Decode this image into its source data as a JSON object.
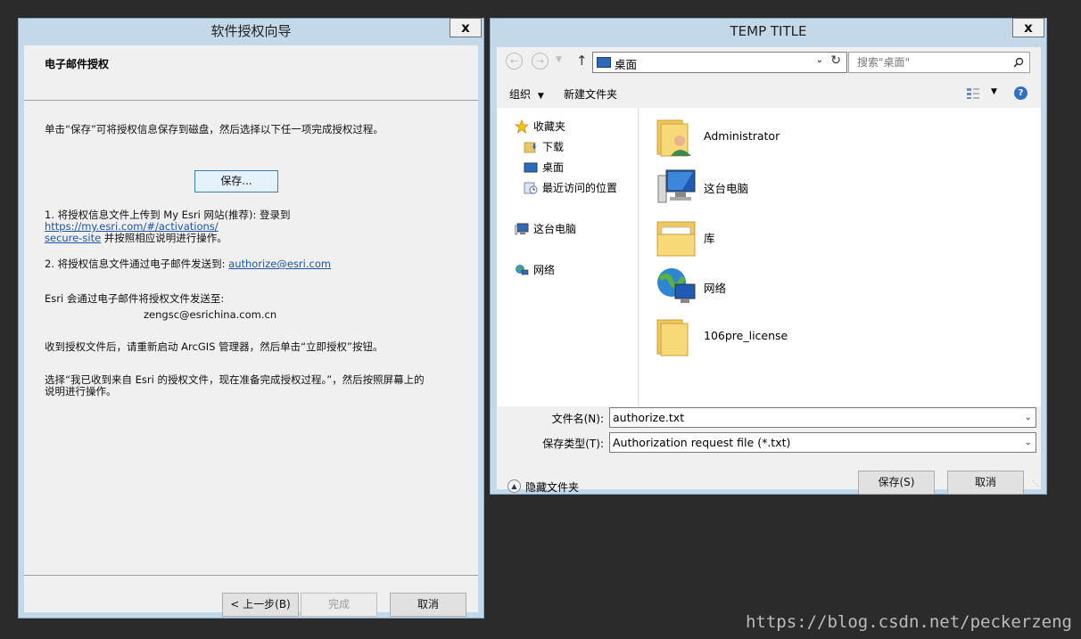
{
  "left_window": {
    "title": "软件授权向导",
    "close_label": "x",
    "header": "电子邮件授权",
    "intro": "单击“保存”可将授权信息保存到磁盘，然后选择以下任一项完成授权过程。",
    "save_button": "保存...",
    "step1_prefix": "1. 将授权信息文件上传到 My Esri 网站(推荐): 登录到 ",
    "step1_link": "https://my.esri.com/#/activations/secure-site",
    "step1_link_line1": "https://my.esri.com/#/activations/",
    "step1_link_line2": "secure-site",
    "step1_suffix": " 并按照相应说明进行操作。",
    "step2_prefix": "2. 将授权信息文件通过电子邮件发送到: ",
    "step2_link": "authorize@esri.com",
    "esri_note": "Esri 会通过电子邮件将授权文件发送至:",
    "email": "zengsc@esrichina.com.cn",
    "restart_note": "收到授权文件后，请重新启动 ArcGIS 管理器，然后单击“立即授权”按钮。",
    "select_note_line1": "选择“我已收到来自 Esri 的授权文件，现在准备完成授权过程。”，然后按照屏幕上的",
    "select_note_line2": "说明进行操作。",
    "back_button": "< 上一步(B)",
    "finish_button": "完成",
    "cancel_button": "取消"
  },
  "right_window": {
    "title": "TEMP TITLE",
    "close_label": "x",
    "address": "桌面",
    "search_placeholder": "搜索\"桌面\"",
    "toolbar": {
      "organize": "组织",
      "new_folder": "新建文件夹"
    },
    "nav": {
      "favorites": "收藏夹",
      "downloads": "下载",
      "desktop": "桌面",
      "recent": "最近访问的位置",
      "this_pc": "这台电脑",
      "network": "网络"
    },
    "files": [
      "Administrator",
      "这台电脑",
      "库",
      "网络",
      "106pre_license"
    ],
    "filename_label": "文件名(N):",
    "filename_value": "authorize.txt",
    "filetype_label": "保存类型(T):",
    "filetype_value": "Authorization request file (*.txt)",
    "hide_folders": "隐藏文件夹",
    "save_button": "保存(S)",
    "cancel_button": "取消"
  },
  "watermark": "https://blog.csdn.net/peckerzeng"
}
